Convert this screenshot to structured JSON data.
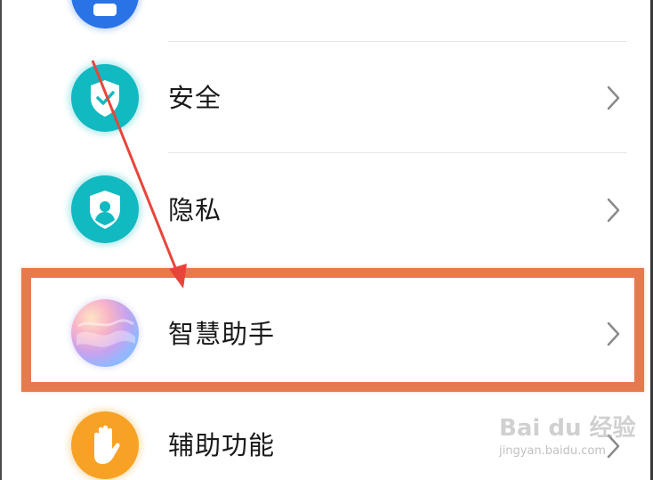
{
  "menu": {
    "items": [
      {
        "label": "安全",
        "icon": "shield-check-icon",
        "color": "#11b9c0"
      },
      {
        "label": "隐私",
        "icon": "shield-user-icon",
        "color": "#11b9c0"
      },
      {
        "label": "智慧助手",
        "icon": "gradient-orb-icon",
        "highlighted": true
      },
      {
        "label": "辅助功能",
        "icon": "hand-icon",
        "color": "#f7a224"
      }
    ]
  },
  "annotation": {
    "highlight_color": "#e7794f",
    "arrow_color": "#e8453a"
  },
  "watermark": {
    "logo_text": "Bai du 经验",
    "url": "jingyan.baidu.com"
  }
}
